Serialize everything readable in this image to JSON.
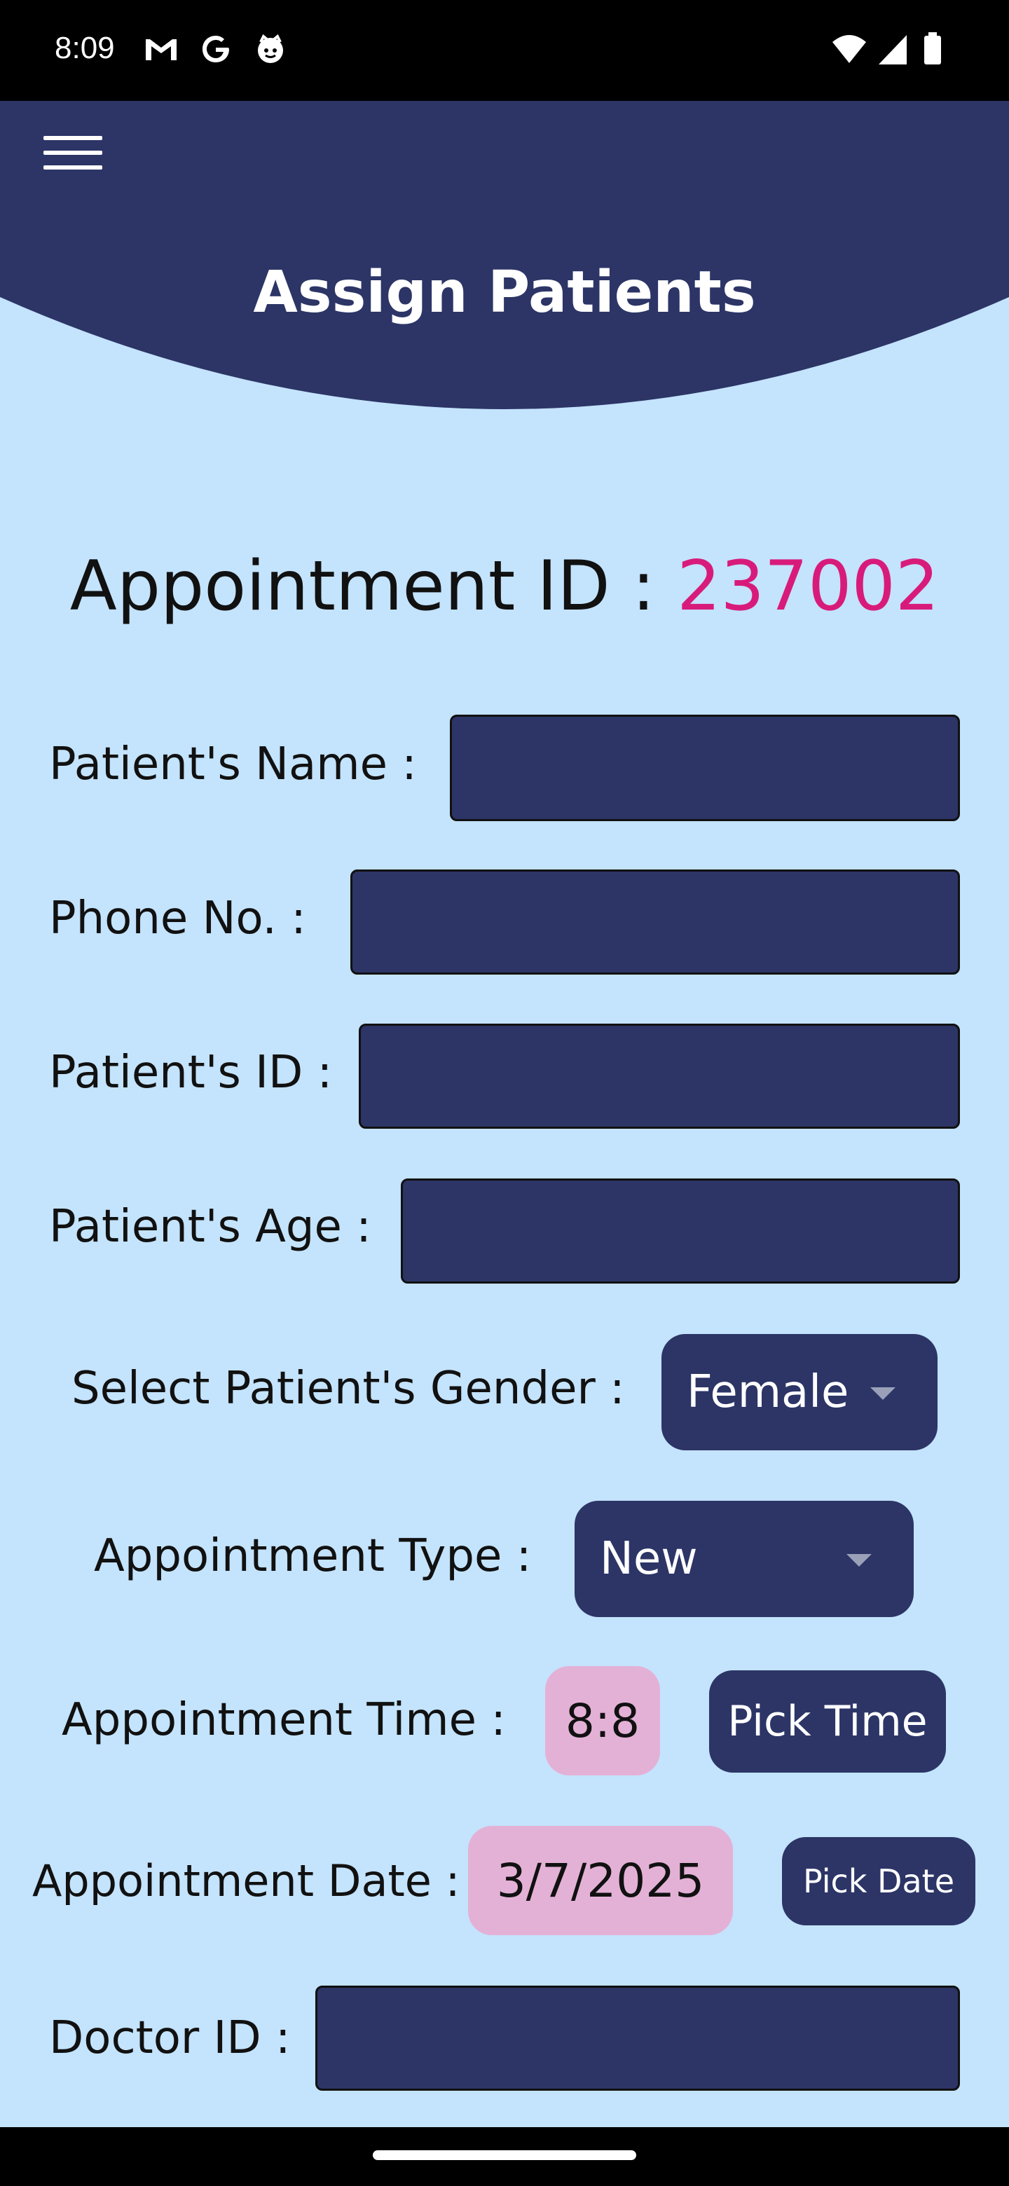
{
  "status_bar": {
    "time": "8:09",
    "left_icons": [
      "gmail-icon",
      "google-icon",
      "face-icon"
    ],
    "right_icons": [
      "wifi-icon",
      "signal-icon",
      "battery-icon"
    ]
  },
  "header": {
    "title": "Assign Patients",
    "menu_icon": "hamburger-menu-icon",
    "color": "#2c3566"
  },
  "appointment_id": {
    "label": "Appointment ID : ",
    "value": "237002",
    "value_color": "#d81b7a"
  },
  "form": {
    "patient_name": {
      "label": "Patient's Name :",
      "value": ""
    },
    "phone": {
      "label": "Phone No.  :",
      "value": ""
    },
    "patient_id": {
      "label": "Patient's ID :",
      "value": ""
    },
    "patient_age": {
      "label": "Patient's Age :",
      "value": ""
    },
    "gender": {
      "label": "Select Patient's Gender :",
      "selected": "Female"
    },
    "appointment_type": {
      "label": "Appointment Type :",
      "selected": "New"
    },
    "appointment_time": {
      "label": "Appointment Time :",
      "value": "8:8",
      "button": "Pick Time"
    },
    "appointment_date": {
      "label": "Appointment Date :",
      "value": "3/7/2025",
      "button": "Pick Date"
    },
    "doctor_id": {
      "label": "Doctor ID :",
      "value": ""
    }
  },
  "colors": {
    "background": "#c4e3fd",
    "primary": "#2c3566",
    "pill": "#e4b1d6"
  }
}
